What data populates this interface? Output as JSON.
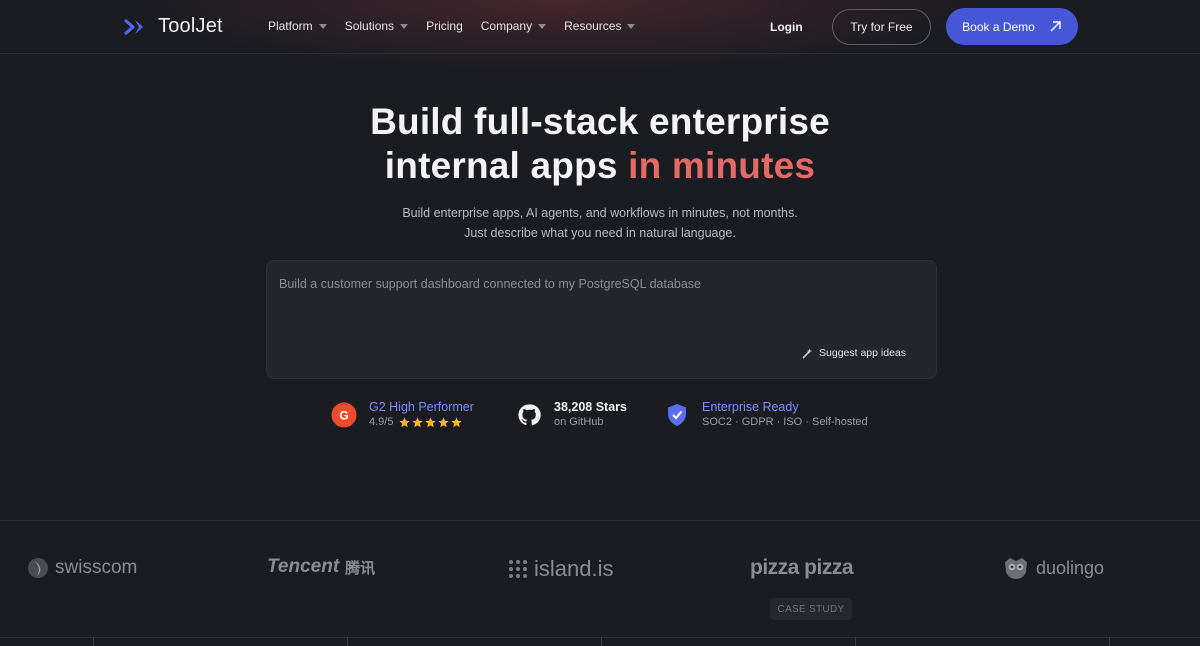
{
  "nav": {
    "logo_text": "ToolJet",
    "links": [
      {
        "label": "Platform",
        "has_dropdown": true
      },
      {
        "label": "Solutions",
        "has_dropdown": true
      },
      {
        "label": "Pricing",
        "has_dropdown": false
      },
      {
        "label": "Company",
        "has_dropdown": true
      },
      {
        "label": "Resources",
        "has_dropdown": true
      }
    ],
    "login_label": "Login",
    "try_label": "Try for Free",
    "demo_label": "Book a Demo"
  },
  "hero": {
    "title_line1": "Build full-stack enterprise",
    "title_line2_plain": "internal apps ",
    "title_line2_accent": "in minutes",
    "subtitle": "Build enterprise apps, AI agents, and workflows in minutes, not months. Just describe what you need in natural language.",
    "prompt_placeholder": "Build a customer support dashboard connected to my PostgreSQL database",
    "prompt_value": "",
    "suggest_label": "Suggest app ideas"
  },
  "badges": {
    "g2": {
      "title": "G2 High Performer",
      "rating": "4.9/5",
      "stars": 5
    },
    "github": {
      "title": "38,208 Stars",
      "sub": "on GitHub"
    },
    "enterprise": {
      "title": "Enterprise Ready",
      "sub": "SOC2 · GDPR · ISO · Self-hosted"
    }
  },
  "customers": {
    "logos": [
      {
        "name": "swisscom"
      },
      {
        "name": "Tencent",
        "suffix": "腾讯"
      },
      {
        "name": "island.is"
      },
      {
        "name": "pizza pizza"
      },
      {
        "name": "duolingo"
      }
    ],
    "case_study_label": "CASE STUDY"
  },
  "colors": {
    "background": "#1b1c22",
    "accent": "#e46a66",
    "primary_button": "#4657d8",
    "link_blue": "#7b8cff",
    "g2_red": "#ef4b2f",
    "star_yellow": "#f5b921"
  }
}
